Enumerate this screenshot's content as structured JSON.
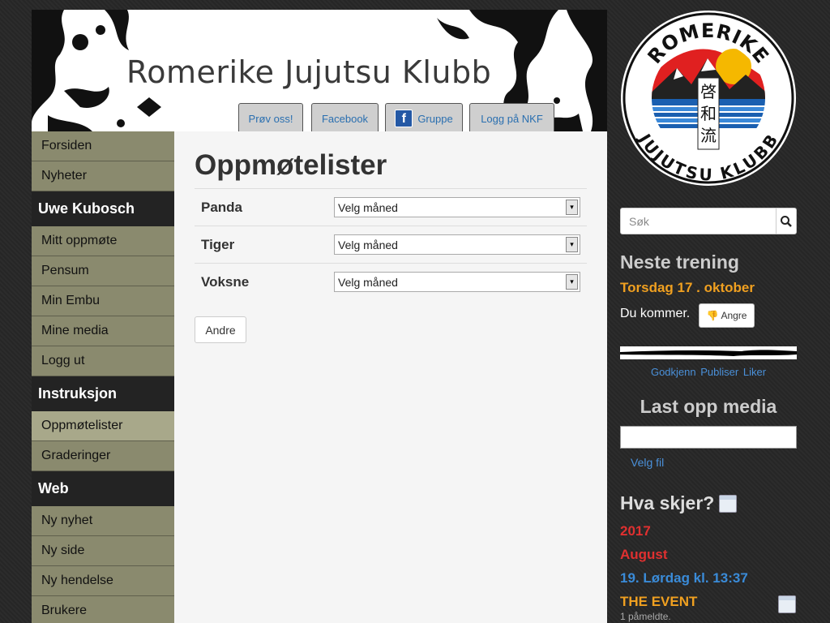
{
  "header": {
    "site_title": "Romerike Jujutsu Klubb",
    "buttons": {
      "prov": "Prøv oss!",
      "facebook": "Facebook",
      "fb_icon": "f",
      "gruppe": "Gruppe",
      "logg_nkf": "Logg på NKF"
    }
  },
  "nav": {
    "forsiden": "Forsiden",
    "nyheter": "Nyheter",
    "user_heading": "Uwe Kubosch",
    "mitt_oppmote": "Mitt oppmøte",
    "pensum": "Pensum",
    "min_embu": "Min Embu",
    "mine_media": "Mine media",
    "logg_ut": "Logg ut",
    "instruksjon_heading": "Instruksjon",
    "oppmotelister": "Oppmøtelister",
    "graderinger": "Graderinger",
    "web_heading": "Web",
    "ny_nyhet": "Ny nyhet",
    "ny_side": "Ny side",
    "ny_hendelse": "Ny hendelse",
    "brukere": "Brukere"
  },
  "main": {
    "title": "Oppmøtelister",
    "rows": [
      {
        "label": "Panda",
        "select": "Velg måned"
      },
      {
        "label": "Tiger",
        "select": "Velg måned"
      },
      {
        "label": "Voksne",
        "select": "Velg måned"
      }
    ],
    "andre_button": "Andre"
  },
  "sidebar": {
    "logo": {
      "top_text": "ROMERIKE",
      "bottom_text": "JUJUTSU KLUBB",
      "kanji": [
        "啓",
        "和",
        "流"
      ]
    },
    "search_placeholder": "Søk",
    "neste_title": "Neste trening",
    "neste_date": "Torsdag 17 . oktober",
    "du_kommer": "Du kommer.",
    "angre": "Angre",
    "media_links": [
      "Godkjenn",
      "Publiser",
      "Liker"
    ],
    "upload_title": "Last opp media",
    "velg_fil": "Velg fil",
    "hva_title": "Hva skjer?",
    "event_year": "2017",
    "event_month": "August",
    "event_day": "19. Lørdag kl. 13:37",
    "event_title": "THE EVENT",
    "event_count": "1 påmeldte."
  },
  "colors": {
    "nav_bg": "#8a8a6e",
    "nav_active": "#a8a88a",
    "accent_orange": "#f0a020",
    "accent_red": "#e03030",
    "link_blue": "#3a8bd8"
  }
}
